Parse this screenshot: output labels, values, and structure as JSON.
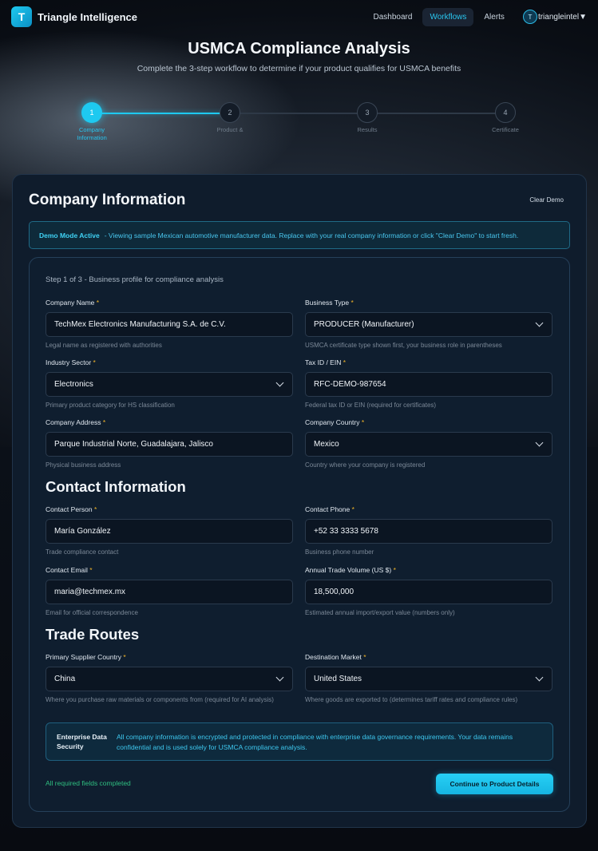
{
  "nav": {
    "logo_letter": "T",
    "brand": "Triangle Intelligence",
    "links": [
      "Dashboard",
      "Workflows",
      "Alerts"
    ],
    "user_initial": "T",
    "user_name": "triangleintel",
    "caret": "▼"
  },
  "hero": {
    "title": "USMCA Compliance Analysis",
    "subtitle": "Complete the 3-step workflow to determine if your product qualifies for USMCA benefits"
  },
  "steps": [
    {
      "num": "1",
      "label": "Company Information",
      "state": "active"
    },
    {
      "num": "2",
      "label": "Product &",
      "state": "inactive"
    },
    {
      "num": "3",
      "label": "Results",
      "state": "inactive"
    },
    {
      "num": "4",
      "label": "Certificate",
      "state": "inactive"
    }
  ],
  "card": {
    "title": "Company Information",
    "clear_demo": "Clear Demo",
    "demo_strong": "Demo Mode Active",
    "demo_msg": "- Viewing sample Mexican automotive manufacturer data. Replace with your real company information or click \"Clear Demo\" to start fresh.",
    "step_subtitle": "Step 1 of 3 - Business profile for compliance analysis"
  },
  "fields": {
    "company_name": {
      "label": "Company Name",
      "value": "TechMex Electronics Manufacturing S.A. de C.V.",
      "help": "Legal name as registered with authorities"
    },
    "business_type": {
      "label": "Business Type",
      "value": "PRODUCER (Manufacturer)",
      "help": "USMCA certificate type shown first, your business role in parentheses"
    },
    "industry_sector": {
      "label": "Industry Sector",
      "value": "Electronics",
      "help": "Primary product category for HS classification"
    },
    "tax_id": {
      "label": "Tax ID / EIN",
      "value": "RFC-DEMO-987654",
      "help": "Federal tax ID or EIN (required for certificates)"
    },
    "company_address": {
      "label": "Company Address",
      "value": "Parque Industrial Norte, Guadalajara, Jalisco",
      "help": "Physical business address"
    },
    "company_country": {
      "label": "Company Country",
      "value": "Mexico",
      "help": "Country where your company is registered"
    },
    "contact_person": {
      "label": "Contact Person",
      "value": "María González",
      "help": "Trade compliance contact"
    },
    "contact_phone": {
      "label": "Contact Phone",
      "value": "+52 33 3333 5678",
      "help": "Business phone number"
    },
    "contact_email": {
      "label": "Contact Email",
      "value": "maria@techmex.mx",
      "help": "Email for official correspondence"
    },
    "trade_volume": {
      "label": "Annual Trade Volume (US $)",
      "value": "18,500,000",
      "help": "Estimated annual import/export value (numbers only)"
    },
    "supplier_country": {
      "label": "Primary Supplier Country",
      "value": "China",
      "help": "Where you purchase raw materials or components from (required for AI analysis)"
    },
    "destination_market": {
      "label": "Destination Market",
      "value": "United States",
      "help": "Where goods are exported to (determines tariff rates and compliance rules)"
    }
  },
  "sections": {
    "contact": "Contact Information",
    "trade": "Trade Routes"
  },
  "security": {
    "title": "Enterprise Data Security",
    "text": "All company information is encrypted and protected in compliance with enterprise data governance requirements. Your data remains confidential and is used solely for USMCA compliance analysis."
  },
  "footer": {
    "status": "All required fields completed",
    "continue": "Continue to Product Details"
  },
  "required_mark": "*",
  "colors": {
    "accent": "#1ec9f0",
    "success": "#2fbf80",
    "required": "#f0b429"
  }
}
